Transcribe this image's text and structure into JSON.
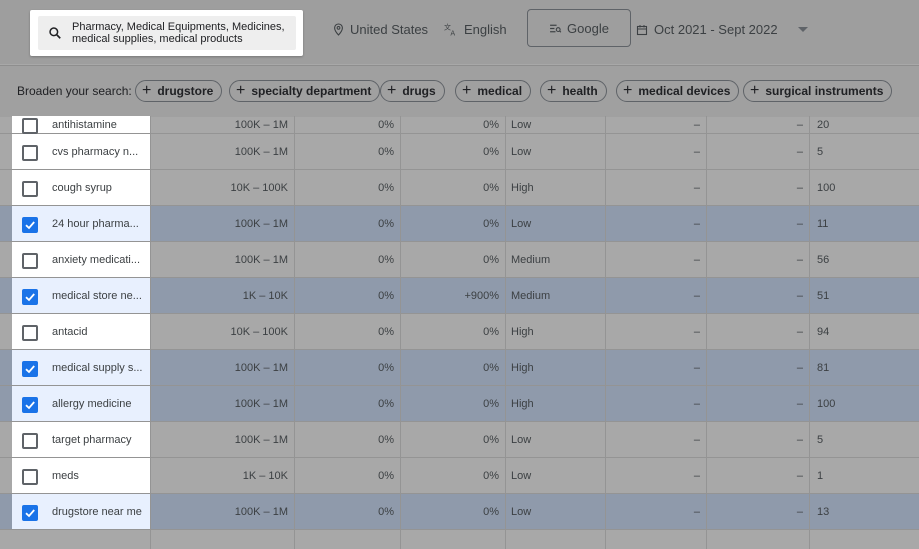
{
  "filters": {
    "search_text": "Pharmacy, Medical Equipments, Medicines, medical supplies, medical products",
    "location": "United States",
    "language": "English",
    "network": "Google",
    "date_range": "Oct 2021 - Sept 2022"
  },
  "broaden": {
    "label": "Broaden your search:",
    "chips": [
      "drugstore",
      "specialty department",
      "drugs",
      "medical",
      "health",
      "medical devices",
      "surgical instruments"
    ]
  },
  "rows": [
    {
      "keyword": "antihistamine",
      "searches": "100K – 1M",
      "three_month": "0%",
      "yoy": "0%",
      "competition": "Low",
      "c1": "–",
      "c2": "–",
      "index": "20",
      "checked": false
    },
    {
      "keyword": "cvs pharmacy n...",
      "searches": "100K – 1M",
      "three_month": "0%",
      "yoy": "0%",
      "competition": "Low",
      "c1": "–",
      "c2": "–",
      "index": "5",
      "checked": false
    },
    {
      "keyword": "cough syrup",
      "searches": "10K – 100K",
      "three_month": "0%",
      "yoy": "0%",
      "competition": "High",
      "c1": "–",
      "c2": "–",
      "index": "100",
      "checked": false
    },
    {
      "keyword": "24 hour pharma...",
      "searches": "100K – 1M",
      "three_month": "0%",
      "yoy": "0%",
      "competition": "Low",
      "c1": "–",
      "c2": "–",
      "index": "11",
      "checked": true
    },
    {
      "keyword": "anxiety medicati...",
      "searches": "100K – 1M",
      "three_month": "0%",
      "yoy": "0%",
      "competition": "Medium",
      "c1": "–",
      "c2": "–",
      "index": "56",
      "checked": false
    },
    {
      "keyword": "medical store ne...",
      "searches": "1K – 10K",
      "three_month": "0%",
      "yoy": "+900%",
      "competition": "Medium",
      "c1": "–",
      "c2": "–",
      "index": "51",
      "checked": true
    },
    {
      "keyword": "antacid",
      "searches": "10K – 100K",
      "three_month": "0%",
      "yoy": "0%",
      "competition": "High",
      "c1": "–",
      "c2": "–",
      "index": "94",
      "checked": false
    },
    {
      "keyword": "medical supply s...",
      "searches": "100K – 1M",
      "three_month": "0%",
      "yoy": "0%",
      "competition": "High",
      "c1": "–",
      "c2": "–",
      "index": "81",
      "checked": true
    },
    {
      "keyword": "allergy medicine",
      "searches": "100K – 1M",
      "three_month": "0%",
      "yoy": "0%",
      "competition": "High",
      "c1": "–",
      "c2": "–",
      "index": "100",
      "checked": true
    },
    {
      "keyword": "target pharmacy",
      "searches": "100K – 1M",
      "three_month": "0%",
      "yoy": "0%",
      "competition": "Low",
      "c1": "–",
      "c2": "–",
      "index": "5",
      "checked": false
    },
    {
      "keyword": "meds",
      "searches": "1K – 10K",
      "three_month": "0%",
      "yoy": "0%",
      "competition": "Low",
      "c1": "–",
      "c2": "–",
      "index": "1",
      "checked": false
    },
    {
      "keyword": "drugstore near me",
      "searches": "100K – 1M",
      "three_month": "0%",
      "yoy": "0%",
      "competition": "Low",
      "c1": "–",
      "c2": "–",
      "index": "13",
      "checked": true
    }
  ],
  "colors": {
    "accent": "#1a73e8",
    "checked_row": "#8f9aab"
  },
  "icons": [
    "search-icon",
    "location-pin-icon",
    "translate-icon",
    "network-icon",
    "calendar-icon",
    "dropdown-arrow-icon",
    "plus-icon",
    "checkbox-icon"
  ]
}
